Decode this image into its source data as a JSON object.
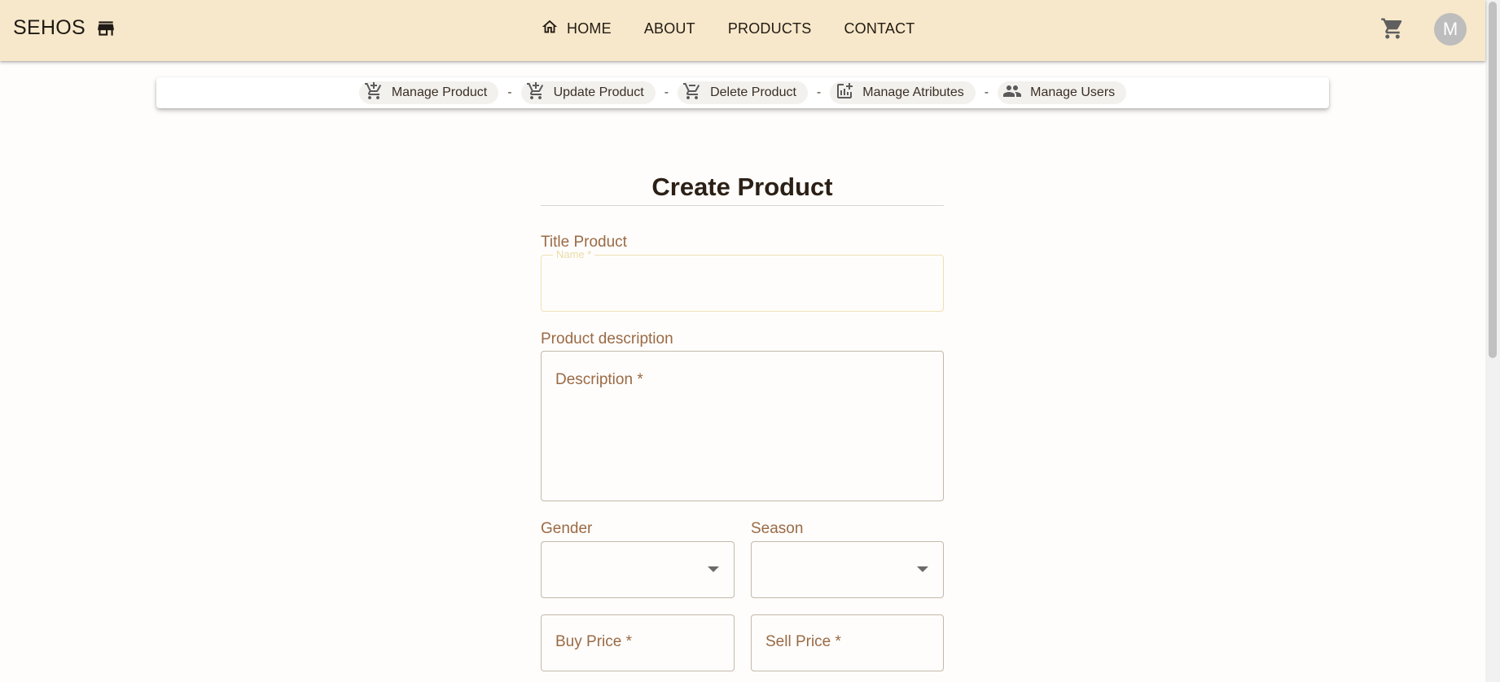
{
  "brand": {
    "name": "SEHOS",
    "icon": "storefront-icon"
  },
  "nav": {
    "items": [
      {
        "label": "HOME",
        "icon": "home-icon"
      },
      {
        "label": "ABOUT"
      },
      {
        "label": "PRODUCTS"
      },
      {
        "label": "CONTACT"
      }
    ],
    "cart_icon": "shopping-cart-icon",
    "avatar_initial": "M"
  },
  "admin_bar": {
    "items": [
      {
        "label": "Manage Product",
        "icon": "add-shopping-cart-icon"
      },
      {
        "label": "Update Product",
        "icon": "add-shopping-cart-icon"
      },
      {
        "label": "Delete Product",
        "icon": "remove-shopping-cart-icon"
      },
      {
        "label": "Manage Atributes",
        "icon": "add-chart-icon"
      },
      {
        "label": "Manage Users",
        "icon": "people-icon"
      }
    ],
    "separator": "-"
  },
  "form": {
    "title": "Create Product",
    "title_label": "Title Product",
    "name_field": {
      "label": "Name *",
      "value": ""
    },
    "description_label": "Product description",
    "description_field": {
      "placeholder": "Description *",
      "value": ""
    },
    "gender_label": "Gender",
    "gender_value": "",
    "season_label": "Season",
    "season_value": "",
    "buy_price": {
      "placeholder": "Buy Price *",
      "value": ""
    },
    "sell_price": {
      "placeholder": "Sell Price *",
      "value": ""
    }
  },
  "colors": {
    "appbar_bg": "#f7e8cb",
    "label_color": "#9a6a45",
    "page_bg": "#fefdfb",
    "avatar_bg": "#bdbdbd"
  }
}
